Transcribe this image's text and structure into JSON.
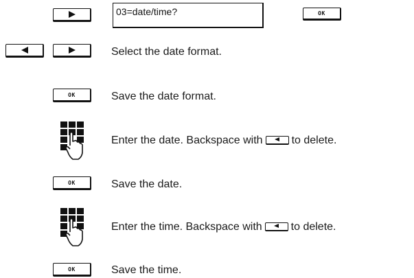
{
  "display": {
    "text": "03=date/time?"
  },
  "keys": {
    "ok_label": "OK"
  },
  "steps": {
    "select_format": "Select the date format.",
    "save_format": "Save the date format.",
    "enter_date_before": "Enter the date. Backspace with",
    "enter_date_after": "to delete.",
    "save_date": "Save the date.",
    "enter_time_before": "Enter the time. Backspace with",
    "enter_time_after": "to delete.",
    "save_time": "Save the time."
  },
  "icons": {
    "right": "right-arrow-key-icon",
    "left": "left-arrow-key-icon",
    "ok": "ok-key-icon",
    "keypad": "keypad-hand-icon",
    "backspace": "backspace-key-icon"
  }
}
